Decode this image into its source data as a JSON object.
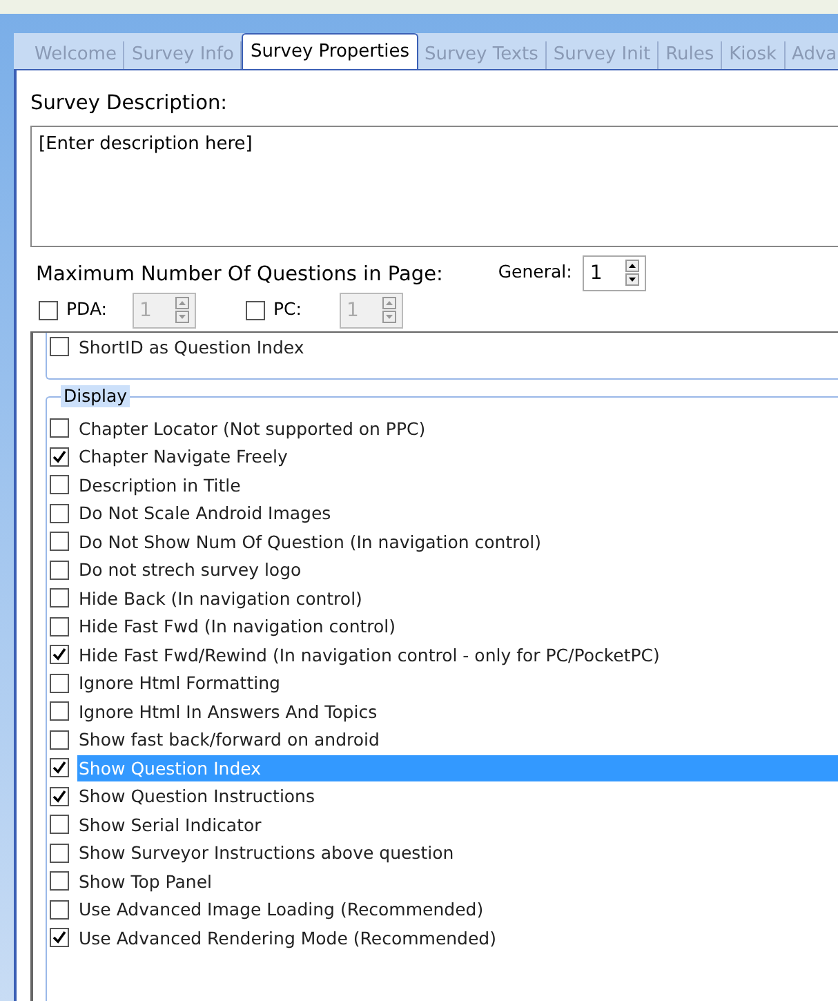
{
  "tabs": [
    {
      "label": "Welcome",
      "selected": false
    },
    {
      "label": "Survey Info",
      "selected": false
    },
    {
      "label": "Survey Properties",
      "selected": true
    },
    {
      "label": "Survey Texts",
      "selected": false
    },
    {
      "label": "Survey Init",
      "selected": false
    },
    {
      "label": "Rules",
      "selected": false
    },
    {
      "label": "Kiosk",
      "selected": false
    },
    {
      "label": "Adva",
      "selected": false
    }
  ],
  "description": {
    "label": "Survey Description:",
    "value": "[Enter description here]"
  },
  "max_questions": {
    "label": "Maximum Number Of Questions in Page:",
    "general": {
      "label": "General:",
      "value": "1"
    },
    "devices": [
      {
        "label": "PDA:",
        "checked": false,
        "value": "1",
        "disabled": true
      },
      {
        "label": "PC:",
        "checked": false,
        "value": "1",
        "disabled": true
      }
    ]
  },
  "upper_group": {
    "options": [
      {
        "label": "ShortID as Question Index",
        "checked": false,
        "selected": false
      }
    ]
  },
  "display_group": {
    "title": "Display",
    "options": [
      {
        "label": "Chapter Locator (Not supported on PPC)",
        "checked": false,
        "selected": false
      },
      {
        "label": "Chapter Navigate Freely",
        "checked": true,
        "selected": false
      },
      {
        "label": "Description in Title",
        "checked": false,
        "selected": false
      },
      {
        "label": "Do Not Scale Android Images",
        "checked": false,
        "selected": false
      },
      {
        "label": "Do Not Show Num Of Question (In navigation control)",
        "checked": false,
        "selected": false
      },
      {
        "label": "Do not strech survey logo",
        "checked": false,
        "selected": false
      },
      {
        "label": "Hide Back (In navigation control)",
        "checked": false,
        "selected": false
      },
      {
        "label": "Hide Fast Fwd (In navigation control)",
        "checked": false,
        "selected": false
      },
      {
        "label": "Hide Fast Fwd/Rewind (In navigation control - only for PC/PocketPC)",
        "checked": true,
        "selected": false
      },
      {
        "label": "Ignore Html Formatting",
        "checked": false,
        "selected": false
      },
      {
        "label": "Ignore Html In Answers And Topics",
        "checked": false,
        "selected": false
      },
      {
        "label": "Show fast back/forward on android",
        "checked": false,
        "selected": false
      },
      {
        "label": "Show Question Index",
        "checked": true,
        "selected": true
      },
      {
        "label": "Show Question Instructions",
        "checked": true,
        "selected": false
      },
      {
        "label": "Show Serial Indicator",
        "checked": false,
        "selected": false
      },
      {
        "label": "Show Surveyor Instructions above question",
        "checked": false,
        "selected": false
      },
      {
        "label": "Show Top Panel",
        "checked": false,
        "selected": false
      },
      {
        "label": "Use Advanced Image Loading (Recommended)",
        "checked": false,
        "selected": false
      },
      {
        "label": "Use Advanced Rendering Mode (Recommended)",
        "checked": true,
        "selected": false
      }
    ]
  }
}
